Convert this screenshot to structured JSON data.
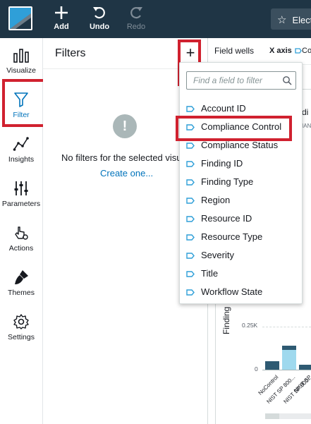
{
  "topbar": {
    "add_label": "Add",
    "undo_label": "Undo",
    "redo_label": "Redo",
    "title_fragment": "Elect",
    "bg_color": "#1f3545"
  },
  "rail": {
    "items": [
      {
        "label": "Visualize",
        "icon": "bar-chart-icon"
      },
      {
        "label": "Filter",
        "icon": "funnel-icon",
        "active": true
      },
      {
        "label": "Insights",
        "icon": "trend-line-icon"
      },
      {
        "label": "Parameters",
        "icon": "sliders-icon"
      },
      {
        "label": "Actions",
        "icon": "pointer-gear-icon"
      },
      {
        "label": "Themes",
        "icon": "paintbrush-icon"
      },
      {
        "label": "Settings",
        "icon": "gear-icon"
      }
    ],
    "active_color": "#0073bb"
  },
  "filters_panel": {
    "title": "Filters",
    "add_button": "+",
    "empty_message": "No filters for the selected visu",
    "create_link": "Create one..."
  },
  "field_wells": {
    "label": "Field wells",
    "x_axis_label": "X axis",
    "x_axis_field_fragment": "Co"
  },
  "visual": {
    "title_fragment": "di",
    "subtitle_fragment": "IAN",
    "y_axis_label_fragment": "Finding",
    "ticks": [
      "0.25K",
      "0"
    ],
    "x_labels": [
      "NoControl",
      "NIST SP 800...",
      "NIST SP 800...",
      "NIST SP"
    ],
    "bar_colors": {
      "dark": "#2e5a72",
      "light": "#9fd9ee"
    }
  },
  "dropdown": {
    "search_placeholder": "Find a field to filter",
    "fields": [
      "Account ID",
      "Compliance Control",
      "Compliance Status",
      "Finding ID",
      "Finding Type",
      "Region",
      "Resource ID",
      "Resource Type",
      "Severity",
      "Title",
      "Workflow State"
    ],
    "tag_color": "#2f9fd8"
  },
  "annotation_color": "#d0212f"
}
